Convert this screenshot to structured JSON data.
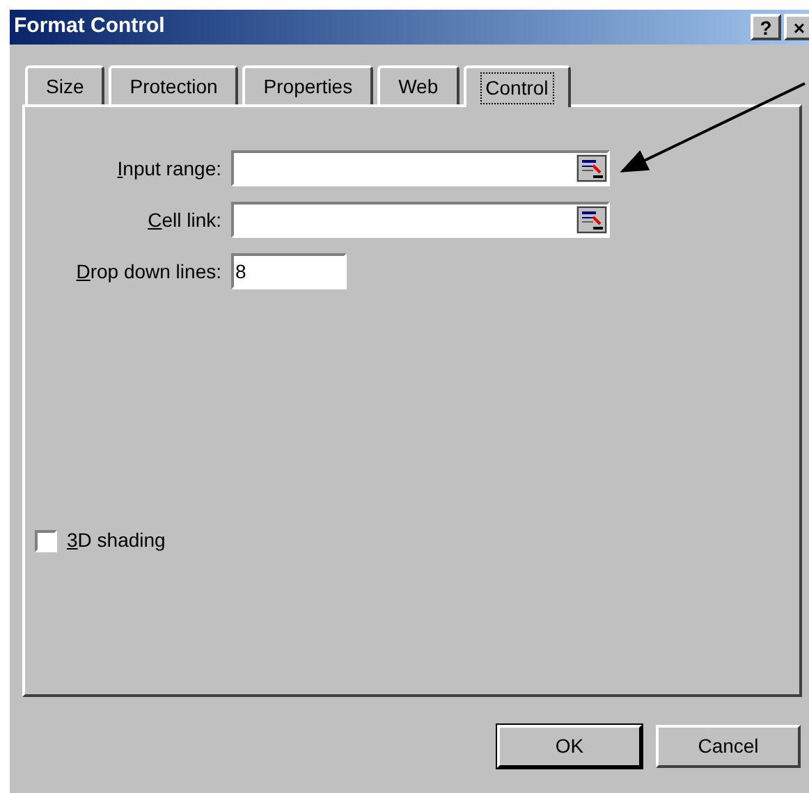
{
  "window": {
    "title": "Format Control",
    "title_buttons": [
      "?",
      "×"
    ]
  },
  "tabs": [
    {
      "label": "Size",
      "selected": false
    },
    {
      "label": "Protection",
      "selected": false
    },
    {
      "label": "Properties",
      "selected": false
    },
    {
      "label": "Web",
      "selected": false
    },
    {
      "label": "Control",
      "selected": true
    }
  ],
  "fields": [
    {
      "label": "Input range:",
      "kind": "range"
    },
    {
      "label": "Cell link:",
      "kind": "range"
    },
    {
      "label": "Drop down lines:",
      "kind": "text",
      "value": "8"
    }
  ],
  "checkbox": {
    "label": "3D shading",
    "checked": false
  },
  "buttons": [
    {
      "label": "OK",
      "default": true
    },
    {
      "label": "Cancel",
      "default": false
    }
  ]
}
